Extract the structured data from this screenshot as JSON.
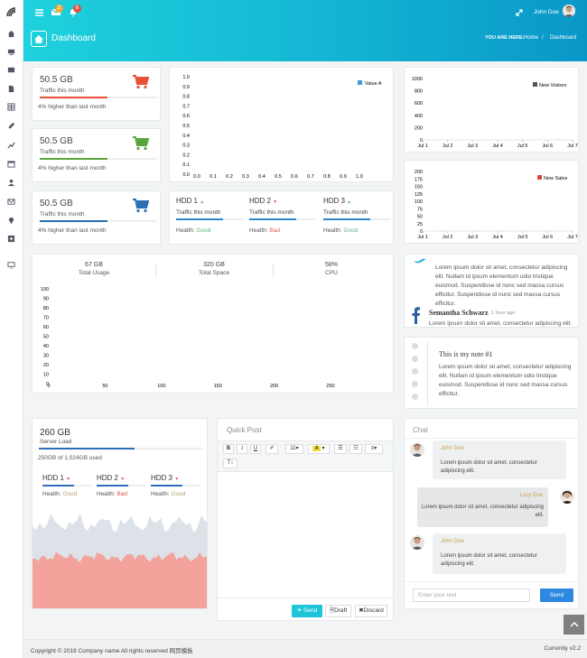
{
  "header": {
    "user_name": "John Doe",
    "mail_badge": "2",
    "bell_badge": "6"
  },
  "page": {
    "title": "Dashboard",
    "breadcrumb_label": "YOU ARE HERE:",
    "breadcrumb_home": "Home",
    "breadcrumb_sep": "/",
    "breadcrumb_current": "Dashboard"
  },
  "stats": [
    {
      "value": "50.5 GB",
      "label": "Traffic this month",
      "note": "4% higher than last month",
      "color": "#e8503a",
      "fill": 0.58
    },
    {
      "value": "50.5 GB",
      "label": "Traffic this month",
      "note": "4% higher than last month",
      "color": "#5aa43e",
      "fill": 0.58
    },
    {
      "value": "50.5 GB",
      "label": "Traffic this month",
      "note": "4% higher than last month",
      "color": "#2b6fb5",
      "fill": 0.58
    }
  ],
  "hdd_row": [
    {
      "title": "HDD 1",
      "label": "Traffic this month",
      "health_label": "Health:",
      "health": "Good",
      "fill": 0.7
    },
    {
      "title": "HDD 2",
      "label": "Traffic this month",
      "health_label": "Health:",
      "health": "Bad",
      "fill": 0.7
    },
    {
      "title": "HDD 3",
      "label": "Traffic this month",
      "health_label": "Health:",
      "health": "Good",
      "fill": 0.7
    }
  ],
  "chart_data": [
    {
      "type": "bar",
      "series": [
        {
          "name": "Value A",
          "values": []
        }
      ],
      "yticks": [
        "1.0",
        "0.9",
        "0.8",
        "0.7",
        "0.6",
        "0.5",
        "0.4",
        "0.3",
        "0.2",
        "0.1",
        "0.0"
      ],
      "xticks": [
        "0.0",
        "0.1",
        "0.2",
        "0.3",
        "0.4",
        "0.5",
        "0.6",
        "0.7",
        "0.8",
        "0.9",
        "1.0"
      ],
      "ylim": [
        0,
        1
      ],
      "xlim": [
        0,
        1
      ]
    },
    {
      "type": "line",
      "series": [
        {
          "name": "New Visitors",
          "values": []
        }
      ],
      "categories": [
        "Jul 1",
        "Jul 2",
        "Jul 3",
        "Jul 4",
        "Jul 5",
        "Jul 6",
        "Jul 7"
      ],
      "yticks": [
        "1000",
        "800",
        "600",
        "400",
        "200",
        "0"
      ],
      "ylim": [
        0,
        1000
      ]
    },
    {
      "type": "line",
      "series": [
        {
          "name": "New Sales",
          "values": []
        }
      ],
      "categories": [
        "Jul 1",
        "Jul 2",
        "Jul 3",
        "Jul 4",
        "Jul 5",
        "Jul 6",
        "Jul 7"
      ],
      "yticks": [
        "200",
        "175",
        "150",
        "125",
        "100",
        "75",
        "50",
        "25",
        "0"
      ],
      "ylim": [
        0,
        200
      ]
    },
    {
      "type": "line",
      "series": [],
      "yticks": [
        "100",
        "90",
        "80",
        "70",
        "60",
        "50",
        "40",
        "30",
        "20",
        "10",
        "0"
      ],
      "xticks": [
        "0",
        "50",
        "100",
        "150",
        "200",
        "250"
      ],
      "ylim": [
        0,
        100
      ],
      "xlim": [
        0,
        250
      ]
    },
    {
      "type": "area",
      "series": [
        {
          "name": "",
          "values": []
        }
      ]
    }
  ],
  "usage": [
    {
      "value": "67 GB",
      "label": "Total Usage"
    },
    {
      "value": "320 GB",
      "label": "Total Space"
    },
    {
      "value": "58%",
      "label": "CPU"
    }
  ],
  "social": {
    "tweet": "Lorem ipsum dolor sit amet, consectetur adipiscing elit. Nullam id ipsum elementum odio tristique euismod. Suspendisse id nunc sed massa cursus efficitur. Suspendisse id nunc sed massa cursus efficitur.",
    "fb_name": "Semantha Schwarz",
    "fb_time": "1 hour ago",
    "fb_text": "Lorem ipsum dolor sit amet, consectetur adipiscing elit."
  },
  "note": {
    "title": "This is my note #1",
    "text": "Lorem ipsum dolor sit amet, consectetur adipiscing elit. Nullam id ipsum elementum odio tristique euismod. Suspendisse id nunc sed massa cursus efficitur."
  },
  "server": {
    "value": "260 GB",
    "label": "Server Load",
    "used": "250GB of 1,024GB used",
    "fill": 0.58
  },
  "server_hdd": [
    {
      "title": "HDD 1",
      "health_label": "Health:",
      "health": "Good"
    },
    {
      "title": "HDD 2",
      "health_label": "Health:",
      "health": "Bad"
    },
    {
      "title": "HDD 3",
      "health_label": "Health:",
      "health": "Good"
    }
  ],
  "quickpost": {
    "title": "Quick Post",
    "font_size": "11",
    "send": "Send",
    "draft": "Draft",
    "discard": "Discard"
  },
  "chat": {
    "title": "Chat",
    "messages": [
      {
        "name": "John Doe",
        "text": "Lorem ipsum dolor sit amet, consectetur adipiscing elit."
      },
      {
        "name": "Lucy Doe",
        "text": "Lorem ipsum dolor sit amet, consectetur adipiscing elit."
      },
      {
        "name": "John Doe",
        "text": "Lorem ipsum dolor sit amet, consectetur adipiscing elit."
      }
    ],
    "placeholder": "Enter your text",
    "send": "Send"
  },
  "footer": {
    "copyright": "Copyright © 2018 Company name All rights reserved 网页模板",
    "version": "Currently v2.2"
  }
}
